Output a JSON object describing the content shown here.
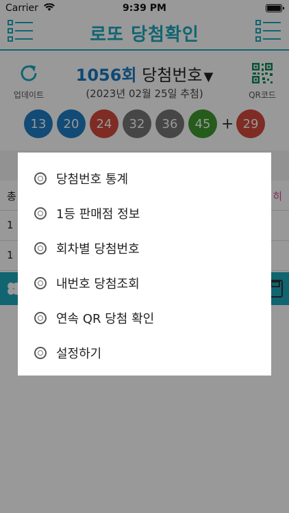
{
  "status_bar": {
    "carrier": "Carrier",
    "time": "9:39 PM",
    "battery_level": 1.0
  },
  "nav": {
    "title": "로또 당첨확인"
  },
  "header": {
    "update_label": "업데이트",
    "qr_label": "QR코드",
    "round": "1056회",
    "round_suffix": "당첨번호",
    "dropdown_arrow": "▼",
    "date": "(2023년 02월 25일 추첨)"
  },
  "balls": [
    {
      "number": "13",
      "color": "#1f7dc4"
    },
    {
      "number": "20",
      "color": "#1f7dc4"
    },
    {
      "number": "24",
      "color": "#d24a3c"
    },
    {
      "number": "32",
      "color": "#757575"
    },
    {
      "number": "36",
      "color": "#757575"
    },
    {
      "number": "45",
      "color": "#3e9a2e"
    }
  ],
  "bonus": {
    "plus": "+",
    "number": "29",
    "color": "#d24a3c"
  },
  "background_rows": [
    {
      "left": "총",
      "right": "히"
    },
    {
      "left": "1",
      "right": ""
    },
    {
      "left": "1",
      "right": ""
    }
  ],
  "menu": {
    "items": [
      {
        "label": "당첨번호 통계"
      },
      {
        "label": "1등 판매점 정보"
      },
      {
        "label": "회차별 당첨번호"
      },
      {
        "label": "내번호 당첨조회"
      },
      {
        "label": "연속 QR 당첨 확인"
      },
      {
        "label": "설정하기"
      }
    ]
  },
  "colors": {
    "accent": "#1ba9bd",
    "round": "#1a78c2"
  }
}
